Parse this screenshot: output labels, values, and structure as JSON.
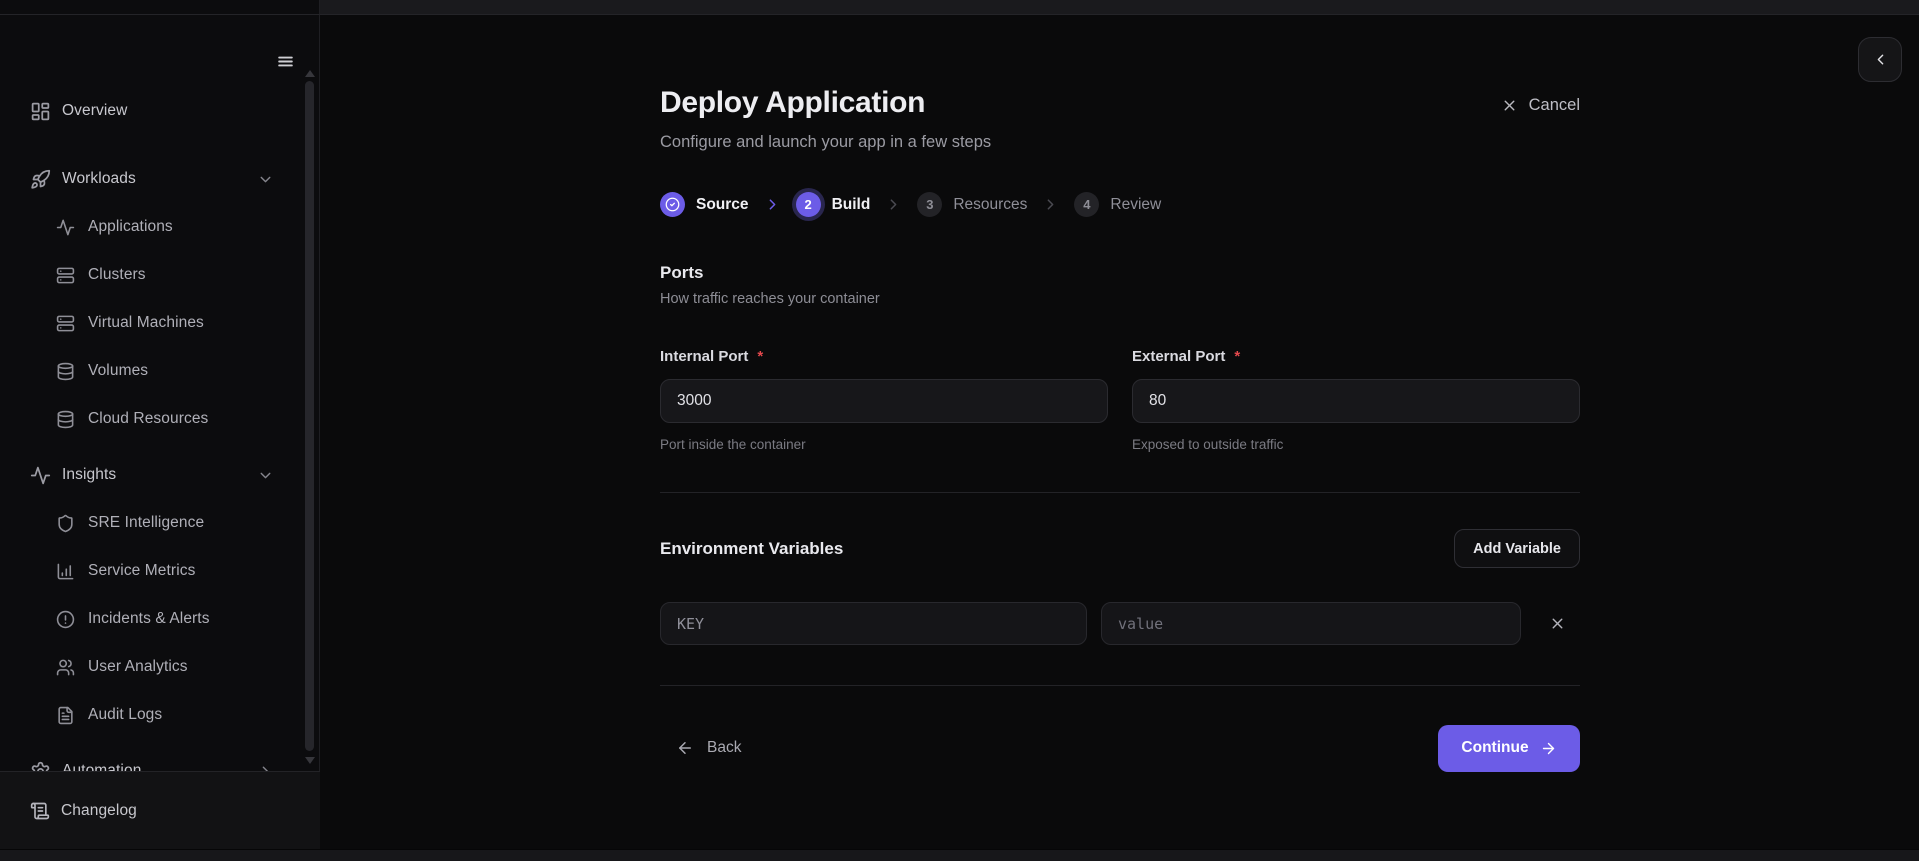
{
  "sidebar": {
    "items": [
      {
        "label": "Overview",
        "icon": "dashboard"
      },
      {
        "label": "Workloads",
        "icon": "rocket",
        "chevron": "down"
      },
      {
        "label": "Applications",
        "icon": "activity"
      },
      {
        "label": "Clusters",
        "icon": "server"
      },
      {
        "label": "Virtual Machines",
        "icon": "server"
      },
      {
        "label": "Volumes",
        "icon": "database"
      },
      {
        "label": "Cloud Resources",
        "icon": "database"
      },
      {
        "label": "Insights",
        "icon": "activity",
        "chevron": "down"
      },
      {
        "label": "SRE Intelligence",
        "icon": "shield"
      },
      {
        "label": "Service Metrics",
        "icon": "bar-chart"
      },
      {
        "label": "Incidents & Alerts",
        "icon": "alert-circle"
      },
      {
        "label": "User Analytics",
        "icon": "users"
      },
      {
        "label": "Audit Logs",
        "icon": "file-text"
      },
      {
        "label": "Automation",
        "icon": "settings",
        "chevron": "right"
      }
    ],
    "footer": {
      "label": "Changelog",
      "icon": "scroll"
    }
  },
  "wizard": {
    "title": "Deploy Application",
    "subtitle": "Configure and launch your app in a few steps",
    "cancel_label": "Cancel",
    "steps": [
      {
        "number": "",
        "label": "Source",
        "state": "complete"
      },
      {
        "number": "2",
        "label": "Build",
        "state": "current"
      },
      {
        "number": "3",
        "label": "Resources",
        "state": "upcoming"
      },
      {
        "number": "4",
        "label": "Review",
        "state": "upcoming"
      }
    ],
    "required_mark": "*",
    "ports": {
      "title": "Ports",
      "description": "How traffic reaches your container",
      "internal": {
        "label": "Internal Port",
        "value": "3000",
        "helper": "Port inside the container"
      },
      "external": {
        "label": "External Port",
        "value": "80",
        "helper": "Exposed to outside traffic"
      }
    },
    "env": {
      "title": "Environment Variables",
      "add_label": "Add Variable",
      "key_placeholder": "KEY",
      "value_placeholder": "value"
    },
    "back_label": "Back",
    "continue_label": "Continue"
  },
  "colors": {
    "accent": "#6c5ce7",
    "required": "#e5484d",
    "background": "#0a0a0b"
  }
}
